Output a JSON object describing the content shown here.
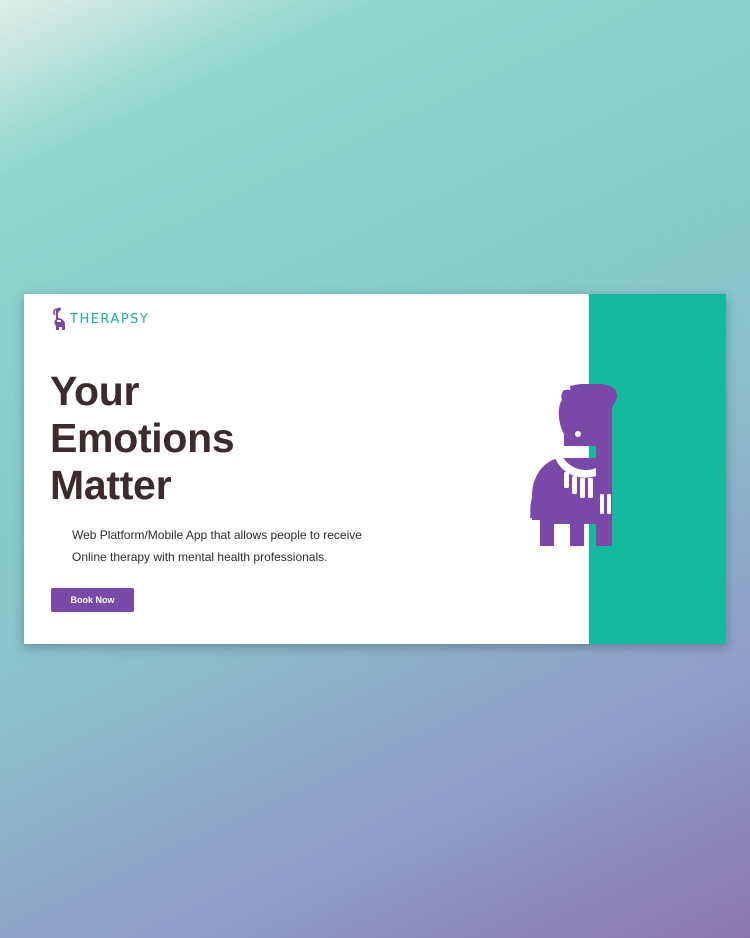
{
  "brand": {
    "name": "THERAPSY",
    "logo_icon": "elephant-icon",
    "accent_color": "#7a48a8",
    "teal_color": "#13b89f"
  },
  "hero": {
    "headline_lines": [
      "Your",
      "Emotions",
      "Matter"
    ],
    "description_lines": [
      "Web Platform/Mobile App that allows people to receive",
      "Online therapy with mental health professionals."
    ],
    "cta_label": "Book Now",
    "illustration_icon": "elephant-icon"
  }
}
